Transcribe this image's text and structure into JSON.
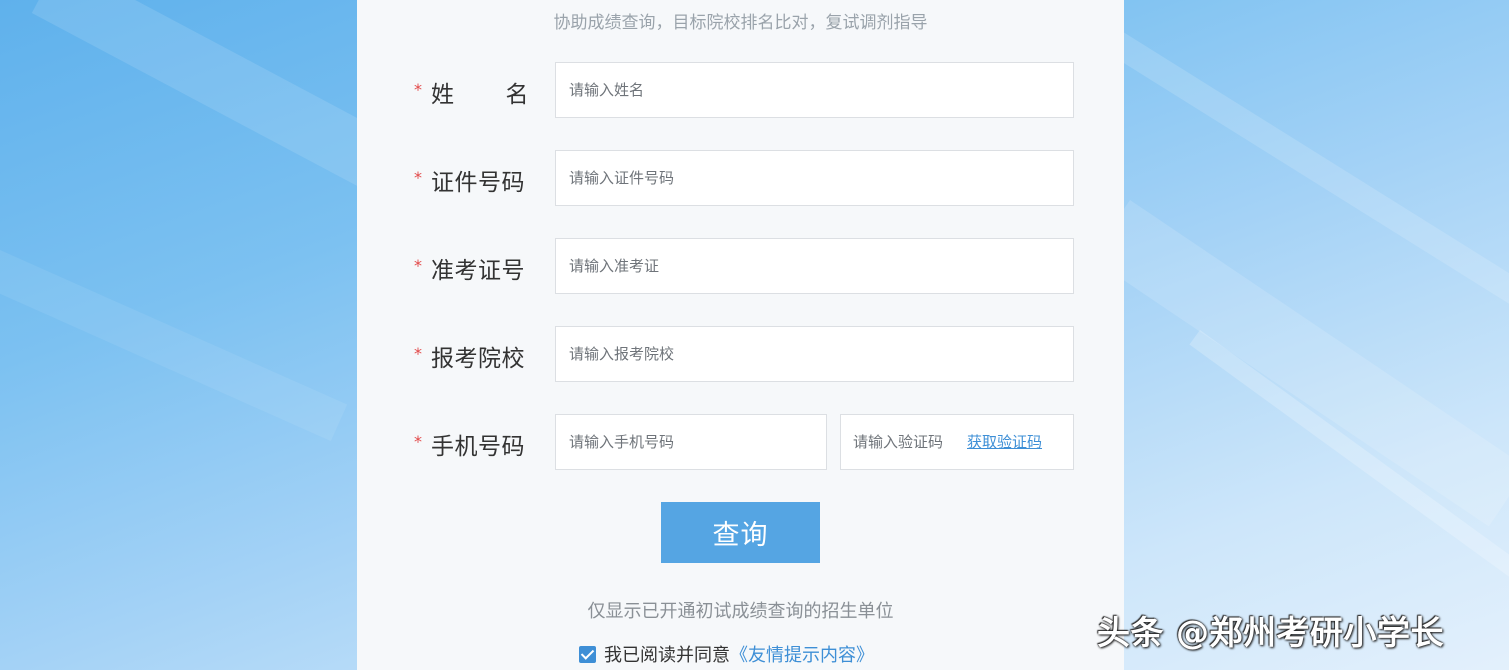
{
  "page": {
    "subtitle": "协助成绩查询，目标院校排名比对，复试调剂指导"
  },
  "form": {
    "required_mark": "*",
    "fields": [
      {
        "label_chars": [
          "姓",
          "名"
        ],
        "placeholder": "请输入姓名"
      },
      {
        "label": "证件号码",
        "placeholder": "请输入证件号码"
      },
      {
        "label": "准考证号",
        "placeholder": "请输入准考证"
      },
      {
        "label": "报考院校",
        "placeholder": "请输入报考院校"
      },
      {
        "label": "手机号码",
        "placeholder": "请输入手机号码"
      }
    ],
    "code": {
      "placeholder": "请输入验证码",
      "link_label": "获取验证码"
    },
    "submit_label": "查询"
  },
  "footer": {
    "note": "仅显示已开通初试成绩查询的招生单位",
    "agree_text": "我已阅读并同意",
    "agree_link": "《友情提示内容》",
    "agree_checked": true
  },
  "watermark": "头条 @郑州考研小学长",
  "colors": {
    "accent": "#55a5e3",
    "link": "#3e8fd6",
    "required": "#e24848"
  },
  "icons": {
    "checkbox": "check-icon"
  }
}
